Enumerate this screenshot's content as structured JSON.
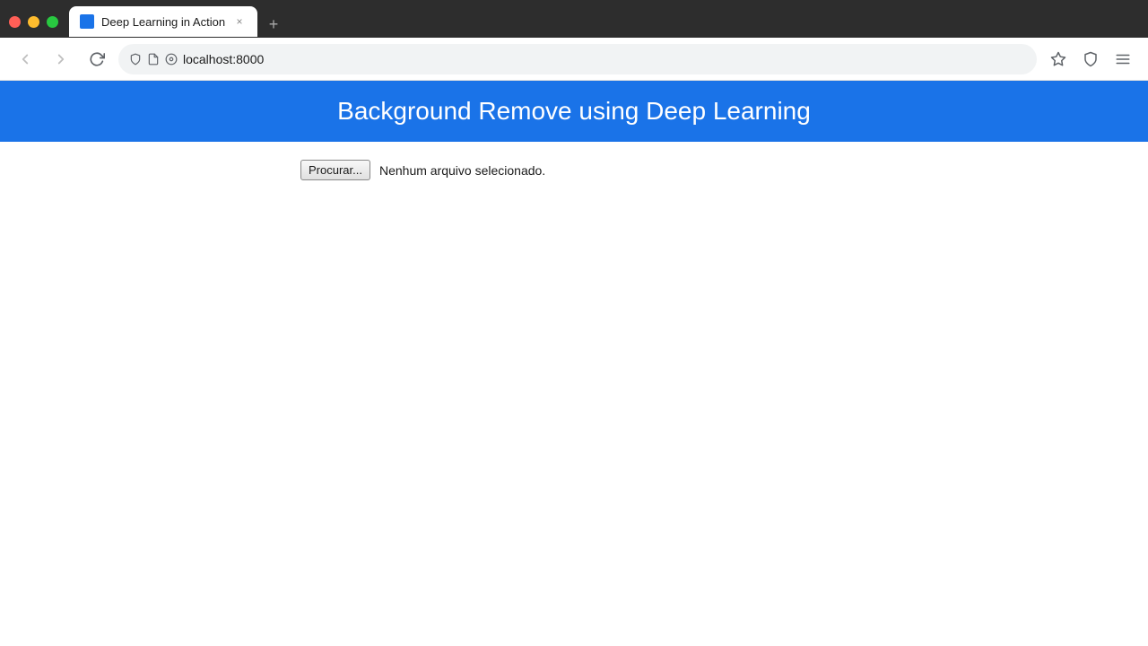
{
  "browser": {
    "tab": {
      "title": "Deep Learning in Action",
      "close_label": "×",
      "new_tab_label": "+"
    },
    "nav": {
      "back_label": "←",
      "forward_label": "→",
      "reload_label": "↻",
      "address": "localhost:8000",
      "bookmark_label": "☆",
      "shield_label": "🛡",
      "menu_label": "☰"
    }
  },
  "page": {
    "header": {
      "title": "Background Remove using Deep Learning"
    },
    "body": {
      "file_button_label": "Procurar...",
      "file_status": "Nenhum arquivo selecionado."
    }
  },
  "colors": {
    "header_bg": "#1a73e8",
    "header_text": "#ffffff",
    "page_bg": "#ffffff"
  }
}
